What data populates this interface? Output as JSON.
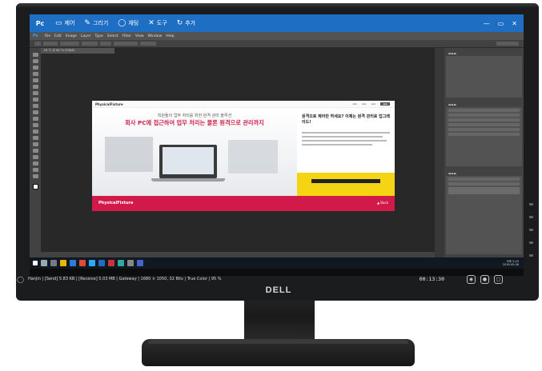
{
  "remote_app": {
    "logo": "Pc",
    "menu": [
      {
        "icon": "display-icon",
        "glyph": "▭",
        "label": "제어"
      },
      {
        "icon": "pen-icon",
        "glyph": "✎",
        "label": "그리기"
      },
      {
        "icon": "chat-icon",
        "glyph": "◯",
        "label": "채팅"
      },
      {
        "icon": "tools-icon",
        "glyph": "✕",
        "label": "도구"
      },
      {
        "icon": "add-icon",
        "glyph": "↻",
        "label": "추가"
      }
    ],
    "window_controls": {
      "minimize": "—",
      "restore": "▭",
      "close": "✕"
    }
  },
  "photoshop": {
    "logo": "Ps",
    "menu": [
      "File",
      "Edit",
      "Image",
      "Layer",
      "Type",
      "Select",
      "Filter",
      "View",
      "Window",
      "Help"
    ],
    "doc_tab": "M1 T1 @ 66.7% (RGB/8)"
  },
  "artboard": {
    "brand": "PhysicalFixture",
    "hero_subtitle": "직원들의 업무 처리를 위한 원격 관리 솔루션",
    "hero_title": "회사 PC에 접근하여 업무 처리는 물론 원격으로 관리까지",
    "side_title": "원격으로 제어만 하세요? 이제는 원격 관리로 업그레이드!",
    "footer_brand": "PhysicalFixture",
    "footer_right": "▲ Back"
  },
  "taskbar": {
    "time": "오후 2:43",
    "date": "2016-05-08"
  },
  "remote_status": {
    "info": "Hanjin | [Send] 5.83 KB | [Receive] 5.03 MB | Gateway | 1680 × 1050, 32 Bits | True Color | 95 %",
    "time": "00:13:30",
    "buttons": [
      {
        "icon": "camera-icon",
        "glyph": "◉"
      },
      {
        "icon": "record-icon",
        "glyph": "●"
      },
      {
        "icon": "fullscreen-icon",
        "glyph": "▢"
      }
    ]
  },
  "monitor": {
    "brand": "DELL"
  }
}
